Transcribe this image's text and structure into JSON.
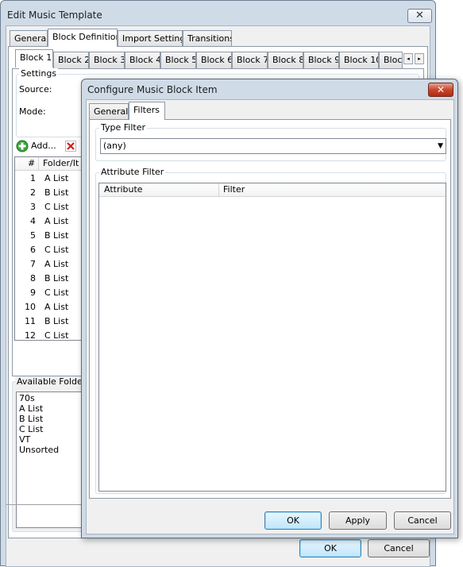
{
  "main_window": {
    "title": "Edit Music Template",
    "close_glyph": "✕",
    "tabs": [
      "General",
      "Block Definition",
      "Import Settings",
      "Transitions"
    ],
    "block_tabs": [
      "Block 1",
      "Block 2",
      "Block 3",
      "Block 4",
      "Block 5",
      "Block 6",
      "Block 7",
      "Block 8",
      "Block 9",
      "Block 10",
      "Block"
    ],
    "settings": {
      "group_label": "Settings",
      "source_label": "Source:",
      "mode_label": "Mode:"
    },
    "add_button_label": "Add...",
    "list_columns": [
      "#",
      "Folder/It"
    ],
    "list_rows": [
      {
        "n": "1",
        "name": "A List"
      },
      {
        "n": "2",
        "name": "B List"
      },
      {
        "n": "3",
        "name": "C List"
      },
      {
        "n": "4",
        "name": "A List"
      },
      {
        "n": "5",
        "name": "B List"
      },
      {
        "n": "6",
        "name": "C List"
      },
      {
        "n": "7",
        "name": "A List"
      },
      {
        "n": "8",
        "name": "B List"
      },
      {
        "n": "9",
        "name": "C List"
      },
      {
        "n": "10",
        "name": "A List"
      },
      {
        "n": "11",
        "name": "B List"
      },
      {
        "n": "12",
        "name": "C List"
      }
    ],
    "available_folders_label": "Available Folders",
    "available_folders": [
      "70s",
      "A List",
      "B List",
      "C List",
      "VT",
      "Unsorted"
    ],
    "ok_label": "OK",
    "cancel_label": "Cancel"
  },
  "dialog": {
    "title": "Configure Music Block Item",
    "close_glyph": "✕",
    "tabs": [
      "General",
      "Filters"
    ],
    "type_filter": {
      "group_label": "Type Filter",
      "selected": "(any)"
    },
    "attribute_filter": {
      "group_label": "Attribute Filter",
      "columns": [
        "Attribute",
        "Filter"
      ]
    },
    "buttons": {
      "ok": "OK",
      "apply": "Apply",
      "cancel": "Cancel"
    }
  },
  "colors": {
    "frame": "#cfdbe7",
    "close_red": "#c7472c",
    "default_button": "#bee6fd"
  },
  "icons": [
    "close-icon",
    "add-icon",
    "delete-icon",
    "scroll-left-icon",
    "scroll-right-icon",
    "dropdown-arrow-icon"
  ]
}
